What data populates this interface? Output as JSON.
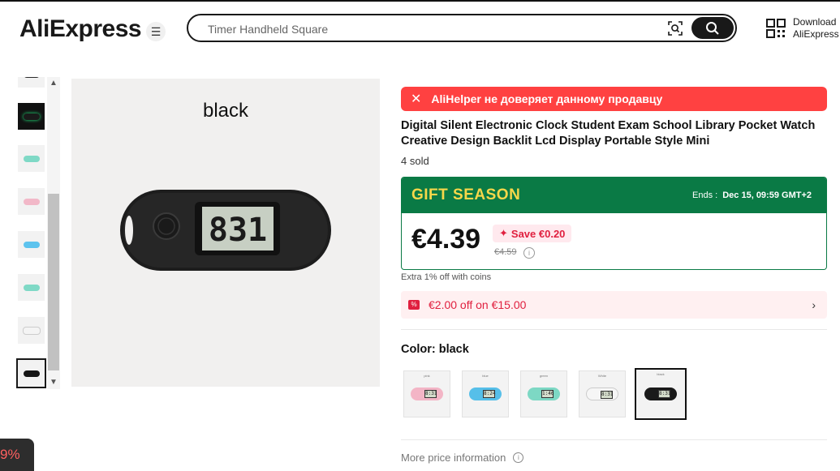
{
  "header": {
    "logo": "AliExpress",
    "search_placeholder": "Timer Handheld Square",
    "download_line1": "Download",
    "download_line2": "AliExpress"
  },
  "gallery": {
    "main_label": "black",
    "thumb_colors": [
      "#2b2b2b",
      "#1a1a1a",
      "#7fd9c6",
      "#f2b8c8",
      "#5dc3ee",
      "#7fd9c6",
      "#f4f4f4",
      "#161616"
    ]
  },
  "product": {
    "alert": "AliHelper не доверяет данному продавцу",
    "title": "Digital Silent Electronic Clock Student Exam School Library Pocket Watch Creative Design Backlit Lcd Display Portable Style Mini",
    "sold": "4 sold"
  },
  "promo": {
    "banner": "GIFT SEASON",
    "ends_label": "Ends :",
    "ends_value": "Dec 15, 09:59 GMT+2",
    "price": "€4.39",
    "save": "Save €0.20",
    "original_price": "€4.59"
  },
  "coins_text": "Extra 1% off with coins",
  "coupon_text": "€2.00 off on €15.00",
  "color": {
    "label": "Color: black",
    "options": [
      {
        "name": "pink",
        "body": "#f3b5c6",
        "screen": "8:31"
      },
      {
        "name": "blue",
        "body": "#56bfe9",
        "screen": "8:24"
      },
      {
        "name": "green",
        "body": "#7dd8c4",
        "screen": "1:46"
      },
      {
        "name": "White",
        "body": "#f6f6f6",
        "screen": "8:31"
      },
      {
        "name": "black",
        "body": "#1a1a1a",
        "screen": "8:31"
      }
    ],
    "selected": "black"
  },
  "more_price": "More price information",
  "extension_badge": "9%"
}
